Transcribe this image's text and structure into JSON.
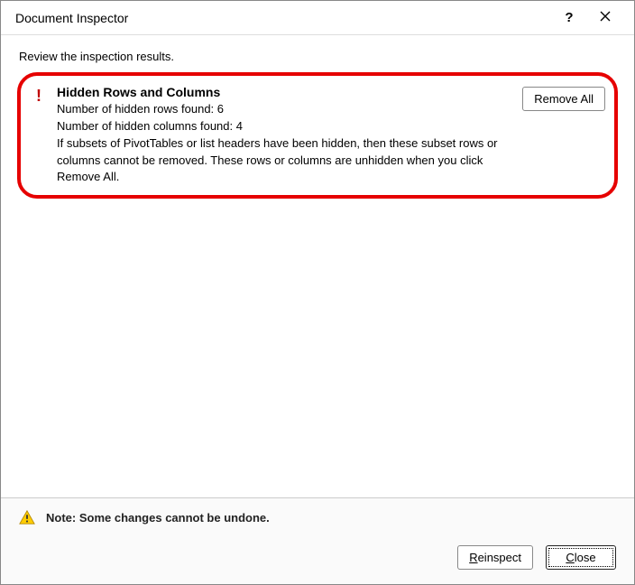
{
  "titlebar": {
    "title": "Document Inspector",
    "help_label": "?",
    "close_label": "Close"
  },
  "subtitle": "Review the inspection results.",
  "result": {
    "icon_label": "alert-icon",
    "icon_glyph": "!",
    "title": "Hidden Rows and Columns",
    "line1": "Number of hidden rows found: 6",
    "line2": "Number of hidden columns found: 4",
    "line3": "If subsets of PivotTables or list headers have been hidden, then these subset rows or columns cannot be removed. These rows or columns are unhidden when you click Remove All.",
    "action_label": "Remove All"
  },
  "footer": {
    "note": "Note: Some changes cannot be undone.",
    "reinspect_prefix": "R",
    "reinspect_suffix": "einspect",
    "close_prefix": "C",
    "close_suffix": "lose"
  }
}
